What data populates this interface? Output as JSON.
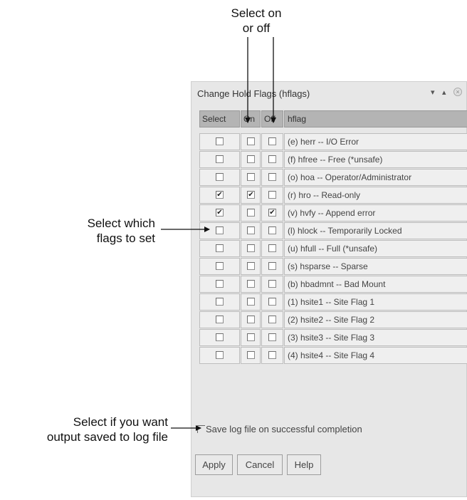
{
  "callouts": {
    "top_line1": "Select on",
    "top_line2": "or off",
    "middle_line1": "Select which",
    "middle_line2": "flags to set",
    "bottom_line1": "Select if you want",
    "bottom_line2": "output saved to log file"
  },
  "panel": {
    "title": "Change Hold Flags (hflags)",
    "controls": [
      "▾",
      "▴",
      "×"
    ]
  },
  "table": {
    "headers": [
      "Select",
      "On",
      "Off",
      "hflag"
    ],
    "rows": [
      {
        "select": false,
        "on": false,
        "off": false,
        "flag": "(e) herr -- I/O Error"
      },
      {
        "select": false,
        "on": false,
        "off": false,
        "flag": "(f) hfree -- Free (*unsafe)"
      },
      {
        "select": false,
        "on": false,
        "off": false,
        "flag": "(o) hoa -- Operator/Administrator"
      },
      {
        "select": true,
        "on": true,
        "off": false,
        "flag": "(r) hro -- Read-only"
      },
      {
        "select": true,
        "on": false,
        "off": true,
        "flag": "(v) hvfy -- Append error"
      },
      {
        "select": false,
        "on": false,
        "off": false,
        "flag": "(l) hlock -- Temporarily Locked"
      },
      {
        "select": false,
        "on": false,
        "off": false,
        "flag": "(u) hfull -- Full (*unsafe)"
      },
      {
        "select": false,
        "on": false,
        "off": false,
        "flag": "(s) hsparse -- Sparse"
      },
      {
        "select": false,
        "on": false,
        "off": false,
        "flag": "(b) hbadmnt -- Bad Mount"
      },
      {
        "select": false,
        "on": false,
        "off": false,
        "flag": "(1) hsite1 -- Site Flag 1"
      },
      {
        "select": false,
        "on": false,
        "off": false,
        "flag": "(2) hsite2 -- Site Flag 2"
      },
      {
        "select": false,
        "on": false,
        "off": false,
        "flag": "(3) hsite3 -- Site Flag 3"
      },
      {
        "select": false,
        "on": false,
        "off": false,
        "flag": "(4) hsite4 -- Site Flag 4"
      }
    ]
  },
  "save_log": {
    "label": "Save log file on successful completion",
    "checked": false
  },
  "buttons": {
    "apply": "Apply",
    "cancel": "Cancel",
    "help": "Help"
  },
  "check_glyph": "✔"
}
